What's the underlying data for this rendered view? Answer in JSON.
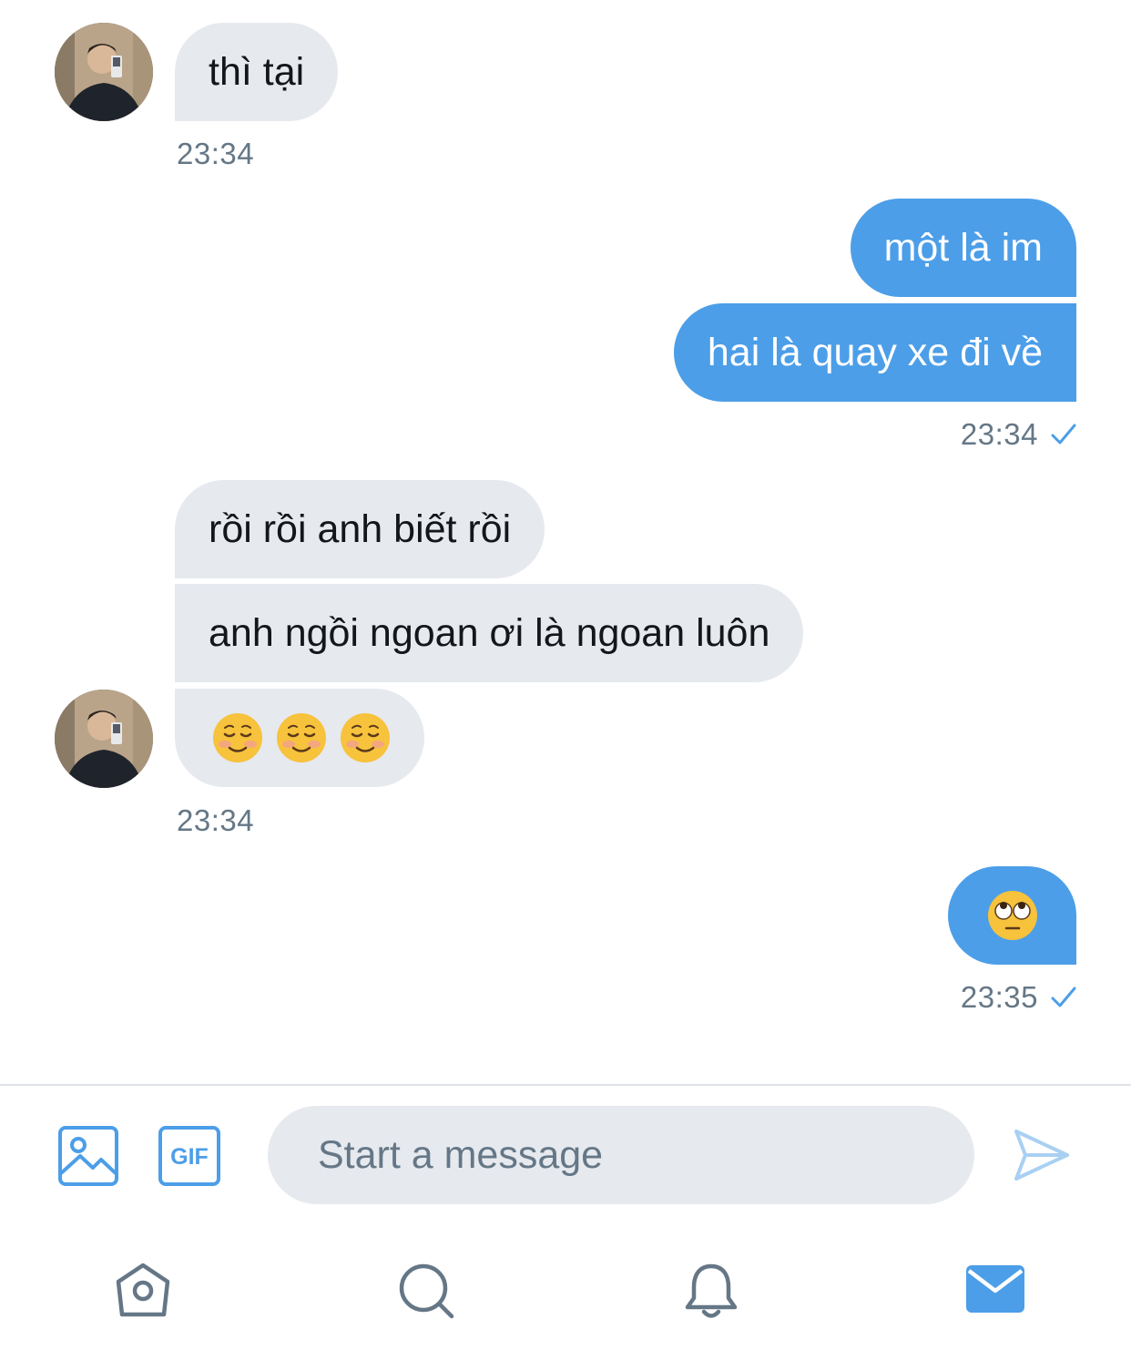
{
  "colors": {
    "accent": "#4c9ee8",
    "incoming_bubble": "#e6e9ee",
    "timestamp": "#657786",
    "icon_gray": "#657786"
  },
  "messages": [
    {
      "direction": "incoming",
      "text": "thì tại"
    },
    {
      "direction": "outgoing",
      "text": "một là im"
    },
    {
      "direction": "outgoing",
      "text": "hai là quay xe đi về"
    },
    {
      "direction": "incoming",
      "text": "rồi rồi anh biết rồi"
    },
    {
      "direction": "incoming",
      "text": "anh ngồi ngoan ơi là ngoan luôn"
    },
    {
      "direction": "incoming",
      "text": "☺️☺️☺️",
      "emoji": [
        "smiling-face-icon",
        "smiling-face-icon",
        "smiling-face-icon"
      ]
    },
    {
      "direction": "outgoing",
      "text": "🙄",
      "emoji": [
        "face-with-rolling-eyes-icon"
      ]
    }
  ],
  "timestamps": {
    "group1": "23:34",
    "group2": "23:34",
    "group3": "23:34",
    "group4": "23:35"
  },
  "composer": {
    "placeholder": "Start a message",
    "gif_label": "GIF",
    "icons": [
      "image-icon",
      "gif-icon",
      "send-icon"
    ]
  },
  "tabbar": {
    "items": [
      "home-icon",
      "search-icon",
      "bell-icon",
      "mail-icon"
    ],
    "active": "mail-icon"
  }
}
